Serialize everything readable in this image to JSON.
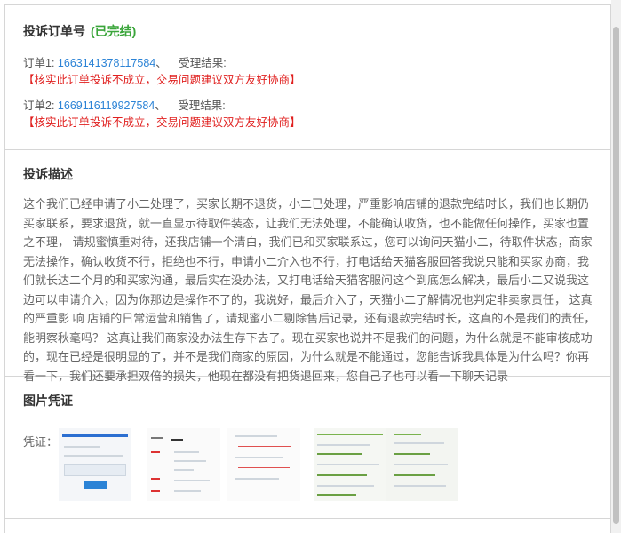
{
  "complaint": {
    "title": "投诉订单号",
    "status": "(已完结)",
    "orders": [
      {
        "label": "订单1:",
        "number": "1663141378117584",
        "sep": "、",
        "result_label": "受理结果:",
        "verdict": "【核实此订单投诉不成立，交易问题建议双方友好协商】"
      },
      {
        "label": "订单2:",
        "number": "1669116119927584",
        "sep": "、",
        "result_label": "受理结果:",
        "verdict": "【核实此订单投诉不成立，交易问题建议双方友好协商】"
      }
    ]
  },
  "description": {
    "title": "投诉描述",
    "text": "这个我们已经申请了小二处理了，买家长期不退货，小二已处理，严重影响店铺的退款完结时长，我们也长期仍买家联系，要求退货，就一直显示待取件装态，让我们无法处理，不能确认收货，也不能做任何操作，买家也置之不理， 请规蜜慎重对待，还我店铺一个清白，我们已和买家联系过，您可以询问天猫小二，待取件状态，商家无法操作，确认收货不行，拒绝也不行，申请小二介入也不行，打电话给天猫客服回答我说只能和买家协商，我们就长达二个月的和买家沟通，最后实在没办法，又打电话给天猫客服问这个到底怎么解决，最后小二又说我这边可以申请介入，因为你那边是操作不了的，我说好，最后介入了，天猫小二了解情况也判定非卖家责任， 这真的严重影 响 店铺的日常运营和销售了，请规蜜小二剔除售后记录，还有退款完结时长，这真的不是我们的责任，能明察秋毫吗？ 这真让我们商家没办法生存下去了。现在买家也说并不是我们的问题，为什么就是不能审核成功的，现在已经是很明显的了，并不是我们商家的原因，为什么就是不能通过，您能告诉我具体是为什么吗？你再看一下，我们还要承担双倍的损失，他现在都没有把货退回来，您自己了也可以看一下聊天记录"
  },
  "evidence": {
    "title": "图片凭证",
    "label": "凭证：",
    "images": [
      "evidence-image-1",
      "evidence-image-2",
      "evidence-image-3",
      "evidence-image-4",
      "evidence-image-5"
    ]
  }
}
